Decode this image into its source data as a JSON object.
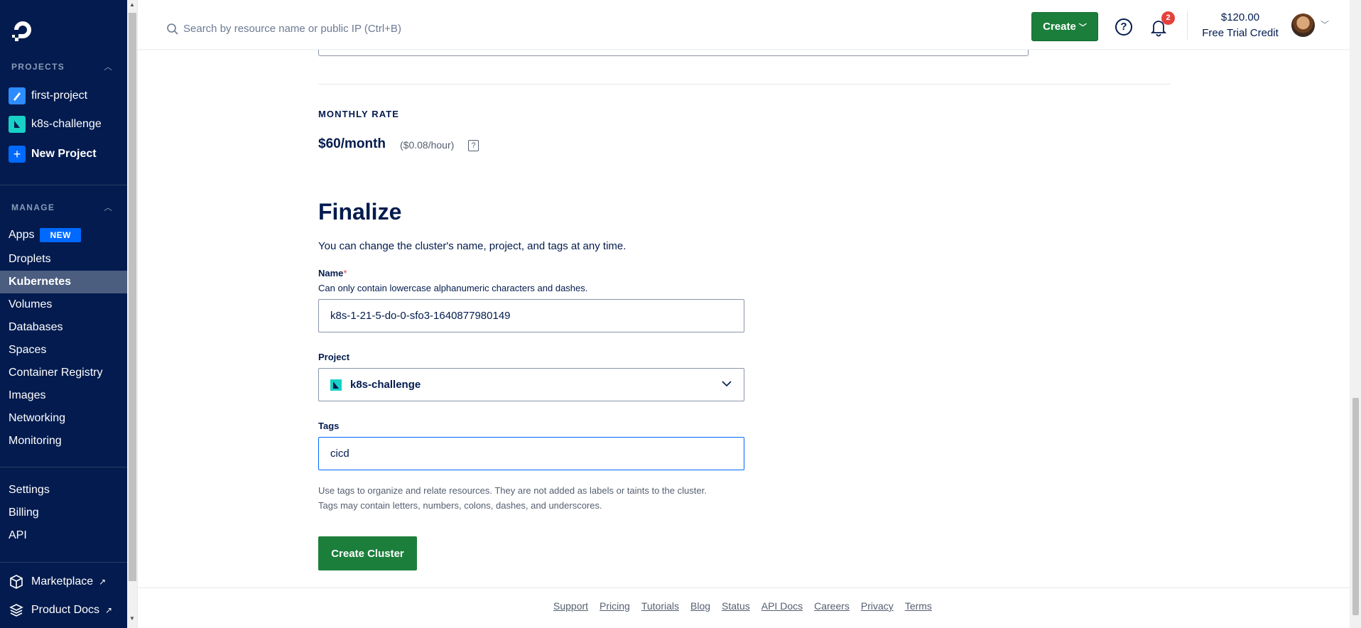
{
  "sidebar": {
    "projects_heading": "PROJECTS",
    "projects": [
      {
        "label": "first-project",
        "icon": "pencil-icon",
        "color": "#2d8cff"
      },
      {
        "label": "k8s-challenge",
        "icon": "kubernetes-project-icon",
        "color": "#17d0c6"
      }
    ],
    "new_project_label": "New Project",
    "manage_heading": "MANAGE",
    "manage_items": [
      {
        "label": "Apps",
        "badge": "NEW"
      },
      {
        "label": "Droplets"
      },
      {
        "label": "Kubernetes",
        "active": true
      },
      {
        "label": "Volumes"
      },
      {
        "label": "Databases"
      },
      {
        "label": "Spaces"
      },
      {
        "label": "Container Registry"
      },
      {
        "label": "Images"
      },
      {
        "label": "Networking"
      },
      {
        "label": "Monitoring"
      }
    ],
    "account_items": [
      {
        "label": "Settings"
      },
      {
        "label": "Billing"
      },
      {
        "label": "API"
      }
    ],
    "external": [
      {
        "label": "Marketplace",
        "icon": "cube-icon"
      },
      {
        "label": "Product Docs",
        "icon": "layers-icon"
      }
    ]
  },
  "header": {
    "search_placeholder": "Search by resource name or public IP (Ctrl+B)",
    "create_label": "Create",
    "notification_count": "2",
    "credit_amount": "$120.00",
    "credit_label": "Free Trial Credit"
  },
  "monthly_rate": {
    "label": "MONTHLY RATE",
    "price": "$60/month",
    "hourly": "($0.08/hour)",
    "help_glyph": "?"
  },
  "finalize": {
    "title": "Finalize",
    "description": "You can change the cluster's name, project, and tags at any time.",
    "name_label": "Name",
    "name_required": "*",
    "name_help": "Can only contain lowercase alphanumeric characters and dashes.",
    "name_value": "k8s-1-21-5-do-0-sfo3-1640877980149",
    "project_label": "Project",
    "project_value": "k8s-challenge",
    "tags_label": "Tags",
    "tags_value": "cicd",
    "tags_help_1": "Use tags to organize and relate resources. They are not added as labels or taints to the cluster.",
    "tags_help_2": "Tags may contain letters, numbers, colons, dashes, and underscores.",
    "submit_label": "Create Cluster"
  },
  "footer_links": [
    "Support",
    "Pricing",
    "Tutorials",
    "Blog",
    "Status",
    "API Docs",
    "Careers",
    "Privacy",
    "Terms"
  ],
  "colors": {
    "sidebar_bg": "#031b4e",
    "active_nav": "#4b5e80",
    "primary_green": "#1b7f3b",
    "accent_blue": "#0069ff",
    "notification_red": "#e5413c"
  }
}
